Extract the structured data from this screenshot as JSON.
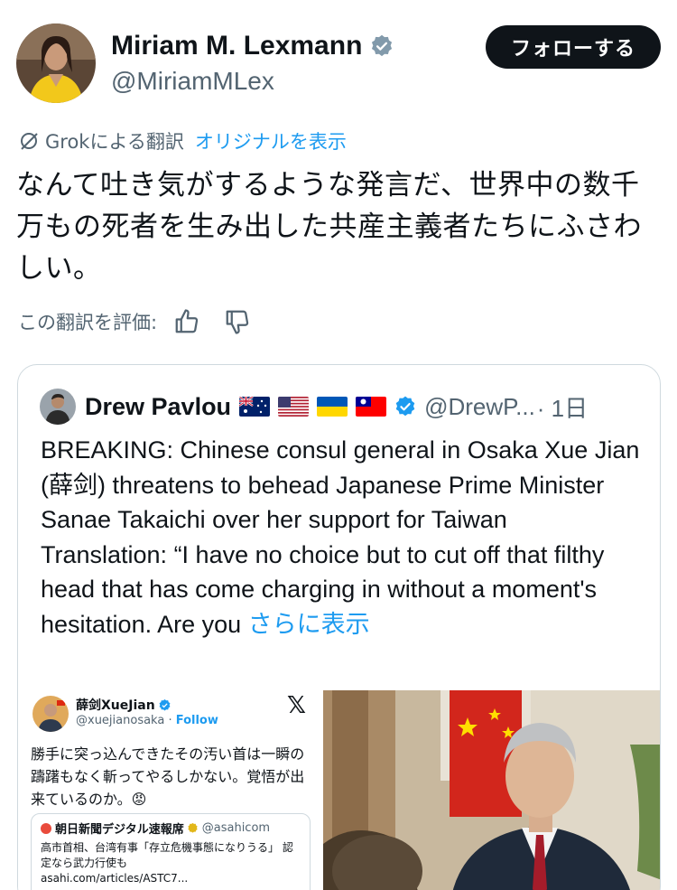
{
  "author": {
    "name": "Miriam M. Lexmann",
    "handle": "@MiriamMLex",
    "follow_label": "フォローする"
  },
  "translation": {
    "label": "Grokによる翻訳",
    "show_original": "オリジナルを表示",
    "rate_label": "この翻訳を評価:"
  },
  "post": {
    "text": "なんて吐き気がするような発言だ、世界中の数千万もの死者を生み出した共産主義者たちにふさわしい。"
  },
  "quote": {
    "name": "Drew Pavlou",
    "handle": "@DrewP...",
    "time": "· 1日",
    "text": "BREAKING: Chinese consul general in Osaka Xue Jian (薛剑) threatens to behead Japanese Prime Minister Sanae Takaichi over her support for Taiwan\nTranslation: “I have no choice but to cut off that filthy head that has come charging in without a moment's hesitation. Are you ",
    "show_more": "さらに表示",
    "flags": [
      "australia-flag",
      "usa-flag",
      "ukraine-flag",
      "taiwan-flag"
    ]
  },
  "media": {
    "embedded_name": "薛剑XueJian",
    "embedded_handle": "@xuejianosaka",
    "embedded_follow": "Follow",
    "embedded_text": "勝手に突っ込んできたその汚い首は一瞬の躊躇もなく斬ってやるしかない。覚悟が出来ているのか。😡",
    "card_source": "朝日新聞デジタル速報席",
    "card_handle": "@asahicom",
    "card_text": "高市首相、台湾有事「存立危機事態になりうる」 認定なら武力行使も",
    "card_link": "asahi.com/articles/ASTC7..."
  },
  "colors": {
    "accent": "#1d9bf0",
    "text": "#0f1419",
    "muted": "#536471",
    "verified_gray": "#829aab"
  }
}
